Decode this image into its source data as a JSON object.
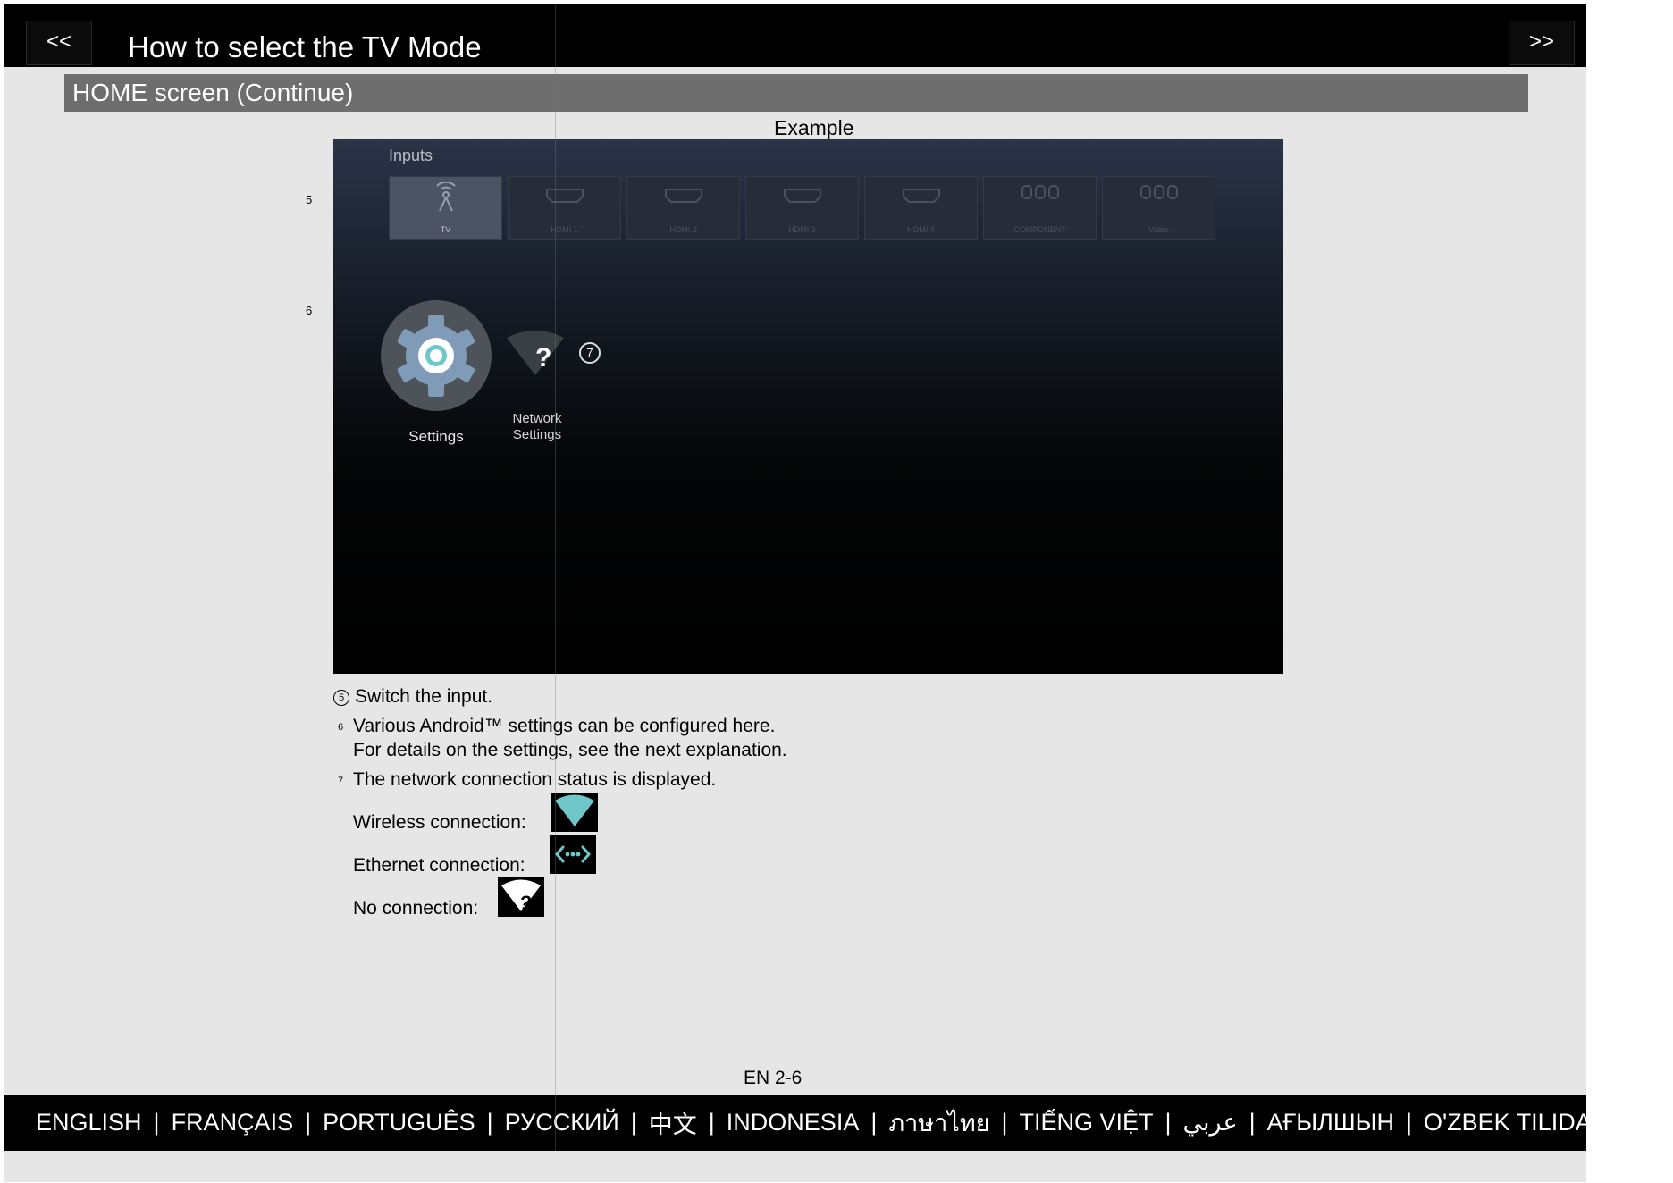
{
  "nav": {
    "prev_label": "<<",
    "next_label": ">>"
  },
  "header": {
    "title": "How to select the TV Mode"
  },
  "section": {
    "title": "HOME screen (Continue)"
  },
  "example_label": "Example",
  "side_callouts": {
    "five": "5",
    "six": "6"
  },
  "tv_screen": {
    "inputs_label": "Inputs",
    "tiles": [
      {
        "label": "TV",
        "icon": "antenna-icon"
      },
      {
        "label": "HDMI 1",
        "icon": "hdmi-icon"
      },
      {
        "label": "HDMI 2",
        "icon": "hdmi-icon"
      },
      {
        "label": "HDMI 3",
        "icon": "hdmi-icon"
      },
      {
        "label": "HDMI 4",
        "icon": "hdmi-icon"
      },
      {
        "label": "COMPONENT",
        "icon": "component-icon"
      },
      {
        "label": "Video",
        "icon": "composite-icon"
      }
    ],
    "settings_label": "Settings",
    "network_label_line1": "Network",
    "network_label_line2": "Settings",
    "callout_seven": "7"
  },
  "descriptions": {
    "item5_marker": "5",
    "item5_text": "Switch the input.",
    "item6_marker": "6",
    "item6_line1": "Various Android™ settings can be configured here.",
    "item6_line2": "For details on the settings, see the next explanation.",
    "item7_marker": "7",
    "item7_text": "The network connection status is displayed.",
    "wireless_label": "Wireless connection:",
    "ethernet_label": "Ethernet connection:",
    "none_label": "No connection:"
  },
  "footer": {
    "page_number": "EN 2-6"
  },
  "languages": [
    "ENGLISH",
    "FRANÇAIS",
    "PORTUGUÊS",
    "РУССКИЙ",
    "中文",
    "INDONESIA",
    "ภาษาไทย",
    "TIẾNG VIỆT",
    "عربي",
    "АҒЫЛШЫН",
    "O'ZBEK TILIDA"
  ],
  "colors": {
    "accent_cyan": "#6fc7c9",
    "section_gray": "#6e6e6e",
    "bar_black": "#000000"
  }
}
